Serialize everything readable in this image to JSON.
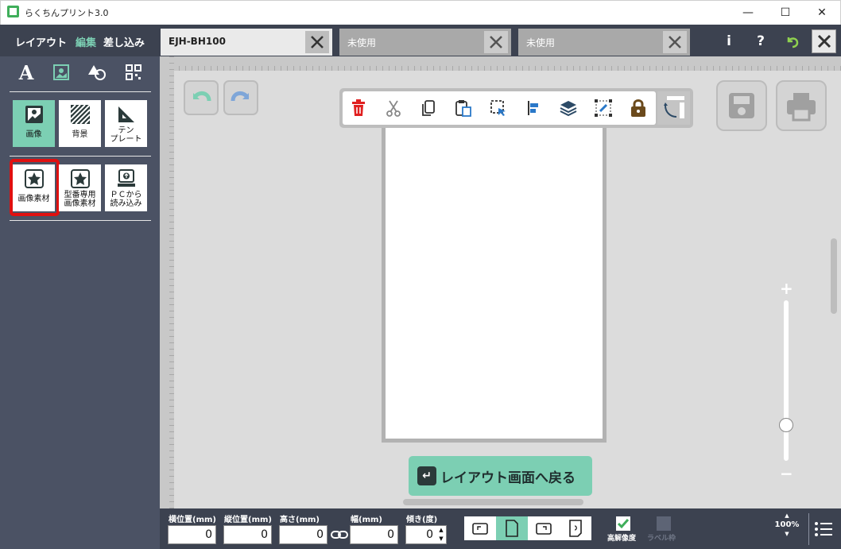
{
  "window": {
    "title": "らくちんプリント3.0",
    "minimize_glyph": "—",
    "maximize_glyph": "☐",
    "close_glyph": "✕"
  },
  "modes": [
    "レイアウト",
    "編集",
    "差し込み"
  ],
  "active_mode": "編集",
  "tabs": [
    {
      "label": "EJH-BH100",
      "active": true
    },
    {
      "label": "未使用",
      "active": false
    },
    {
      "label": "未使用",
      "active": false
    }
  ],
  "top_icons": {
    "info": "i",
    "help": "?"
  },
  "sidebar": {
    "top_icons": [
      "text-icon",
      "image-icon",
      "shape-icon",
      "qrcode-icon"
    ],
    "text_glyph": "A",
    "category_tiles": [
      {
        "label": "画像",
        "icon": "image-icon",
        "selected": true
      },
      {
        "label": "背景",
        "icon": "background-icon",
        "selected": false
      },
      {
        "label": "テン\nプレート",
        "icon": "template-icon",
        "selected": false
      }
    ],
    "source_tiles": [
      {
        "label": "画像素材",
        "icon": "star-image-icon",
        "highlighted": true
      },
      {
        "label": "型番専用\n画像素材",
        "icon": "star-model-icon",
        "highlighted": false
      },
      {
        "label": "ＰＣから\n読み込み",
        "icon": "pc-import-icon",
        "highlighted": false
      }
    ]
  },
  "toolbar_items": [
    "delete-icon",
    "cut-icon",
    "copy-icon",
    "paste-icon",
    "select-icon",
    "align-icon",
    "layer-icon",
    "link-icon",
    "lock-icon",
    "rotate-frame-icon"
  ],
  "back_button": {
    "label": "レイアウト画面へ戻る"
  },
  "zoom": {
    "plus": "+",
    "minus": "−",
    "level_label": "100%"
  },
  "fields": [
    {
      "label": "横位置(mm)",
      "value": "0"
    },
    {
      "label": "縦位置(mm)",
      "value": "0"
    },
    {
      "label": "高さ(mm)",
      "value": "0"
    },
    {
      "label": "幅(mm)",
      "value": "0"
    },
    {
      "label": "傾き(度)",
      "value": "0"
    }
  ],
  "checkboxes": [
    {
      "label": "高解像度",
      "checked": true
    },
    {
      "label": "ラベル枠",
      "checked": false
    }
  ],
  "colors": {
    "accent": "#7ccfb3",
    "dark_bar": "#3c4250",
    "sidebar": "#4b5264",
    "highlight": "#e01010",
    "delete": "#e02020",
    "lock": "#6b4a1c"
  }
}
